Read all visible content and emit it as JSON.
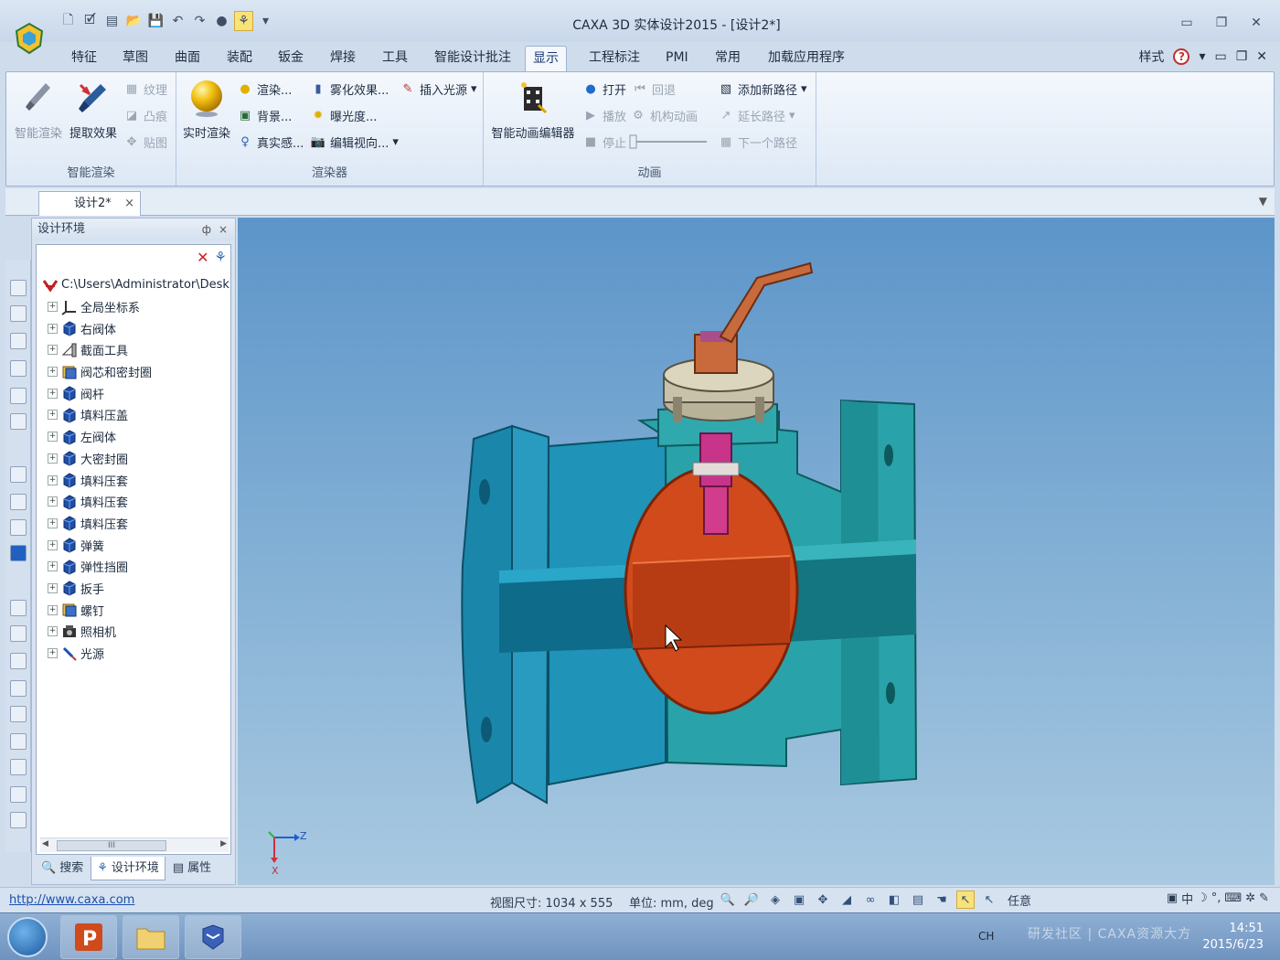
{
  "window": {
    "title": "CAXA 3D 实体设计2015 - [设计2*]"
  },
  "ribbon": {
    "tabs": [
      "特征",
      "草图",
      "曲面",
      "装配",
      "钣金",
      "焊接",
      "工具",
      "智能设计批注",
      "显示",
      "工程标注",
      "PMI",
      "常用",
      "加载应用程序"
    ],
    "active_tab": "显示",
    "right": {
      "style_label": "样式",
      "help": "?"
    },
    "groups": {
      "smart_render": {
        "label": "智能渲染",
        "smart_render_btn": "智能渲染",
        "extract_effect_btn": "提取效果",
        "texture": "纹理",
        "bump": "凸痕",
        "decal": "贴图"
      },
      "renderer": {
        "label": "渲染器",
        "realtime_render_btn": "实时渲染",
        "render": "渲染...",
        "background": "背景...",
        "realism": "真实感...",
        "fog_effect": "雾化效果...",
        "exposure": "曝光度...",
        "edit_view": "编辑视向...",
        "insert_light": "插入光源"
      },
      "animation": {
        "label": "动画",
        "editor_btn": "智能动画编辑器",
        "open": "打开",
        "rewind": "回退",
        "play": "播放",
        "mechanism": "机构动画",
        "stop": "停止",
        "add_path": "添加新路径",
        "extend_path": "延长路径",
        "next_path": "下一个路径"
      }
    }
  },
  "document_tab": {
    "label": "设计2*",
    "close": "×"
  },
  "panel": {
    "title": "设计环境",
    "pin": "ф",
    "close": "×",
    "tree": [
      {
        "label": "C:\\Users\\Administrator\\Desk",
        "icon": "design-root-icon",
        "root": true
      },
      {
        "label": "全局坐标系",
        "icon": "axes-icon"
      },
      {
        "label": "右阀体",
        "icon": "part-icon"
      },
      {
        "label": "截面工具",
        "icon": "section-tool-icon"
      },
      {
        "label": "阀芯和密封圈",
        "icon": "assembly-icon"
      },
      {
        "label": "阀杆",
        "icon": "part-icon"
      },
      {
        "label": "填料压盖",
        "icon": "part-icon"
      },
      {
        "label": "左阀体",
        "icon": "part-icon"
      },
      {
        "label": "大密封圈",
        "icon": "part-icon"
      },
      {
        "label": "填料压套",
        "icon": "part-icon"
      },
      {
        "label": "填料压套",
        "icon": "part-icon"
      },
      {
        "label": "填料压套",
        "icon": "part-icon"
      },
      {
        "label": "弹簧",
        "icon": "part-icon"
      },
      {
        "label": "弹性挡圈",
        "icon": "part-icon"
      },
      {
        "label": "扳手",
        "icon": "part-icon"
      },
      {
        "label": "螺钉",
        "icon": "assembly-icon"
      },
      {
        "label": "照相机",
        "icon": "camera-icon"
      },
      {
        "label": "光源",
        "icon": "light-icon"
      }
    ],
    "scroll_thumb": "III",
    "tabs": [
      {
        "label": "搜索",
        "icon": "search-icon"
      },
      {
        "label": "设计环境",
        "icon": "design-env-icon"
      },
      {
        "label": "属性",
        "icon": "properties-icon"
      }
    ]
  },
  "viewport": {
    "axis_z": "Z",
    "axis_x": "X",
    "colors": {
      "body": "#1e8fb2",
      "ball": "#d04a1c",
      "handle": "#c86a3c",
      "stem": "#d23c8c",
      "gland": "#c9c2aa"
    }
  },
  "status": {
    "link": "http://www.caxa.com",
    "view_size": "视图尺寸: 1034 x 555",
    "units": "单位: mm, deg",
    "filter": "任意",
    "ime": [
      "中",
      "♪"
    ]
  },
  "taskbar": {
    "lang": "CH",
    "watermark": "研发社区 | CAXA资源大方",
    "time": "14:51",
    "date": "2015/6/23"
  }
}
